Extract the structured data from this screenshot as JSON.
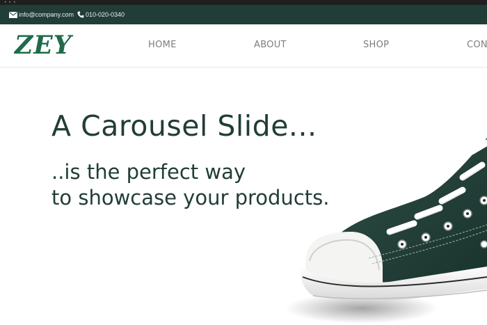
{
  "header": {
    "email": "info@company.com",
    "phone": "010-020-0340"
  },
  "nav": {
    "logo": "ZEY",
    "items": [
      {
        "label": "HOME"
      },
      {
        "label": "ABOUT"
      },
      {
        "label": "SHOP"
      },
      {
        "label": "CON"
      }
    ]
  },
  "hero": {
    "title": "A Carousel Slide...",
    "subtitle_line1": "..is the perfect way",
    "subtitle_line2": "to showcase your products."
  },
  "colors": {
    "topbar": "#213d37",
    "brand_green": "#1f6b4a",
    "heading": "#213d37",
    "shoe_canvas": "#233f38"
  },
  "icons": {
    "email": "envelope-icon",
    "phone": "phone-icon"
  }
}
